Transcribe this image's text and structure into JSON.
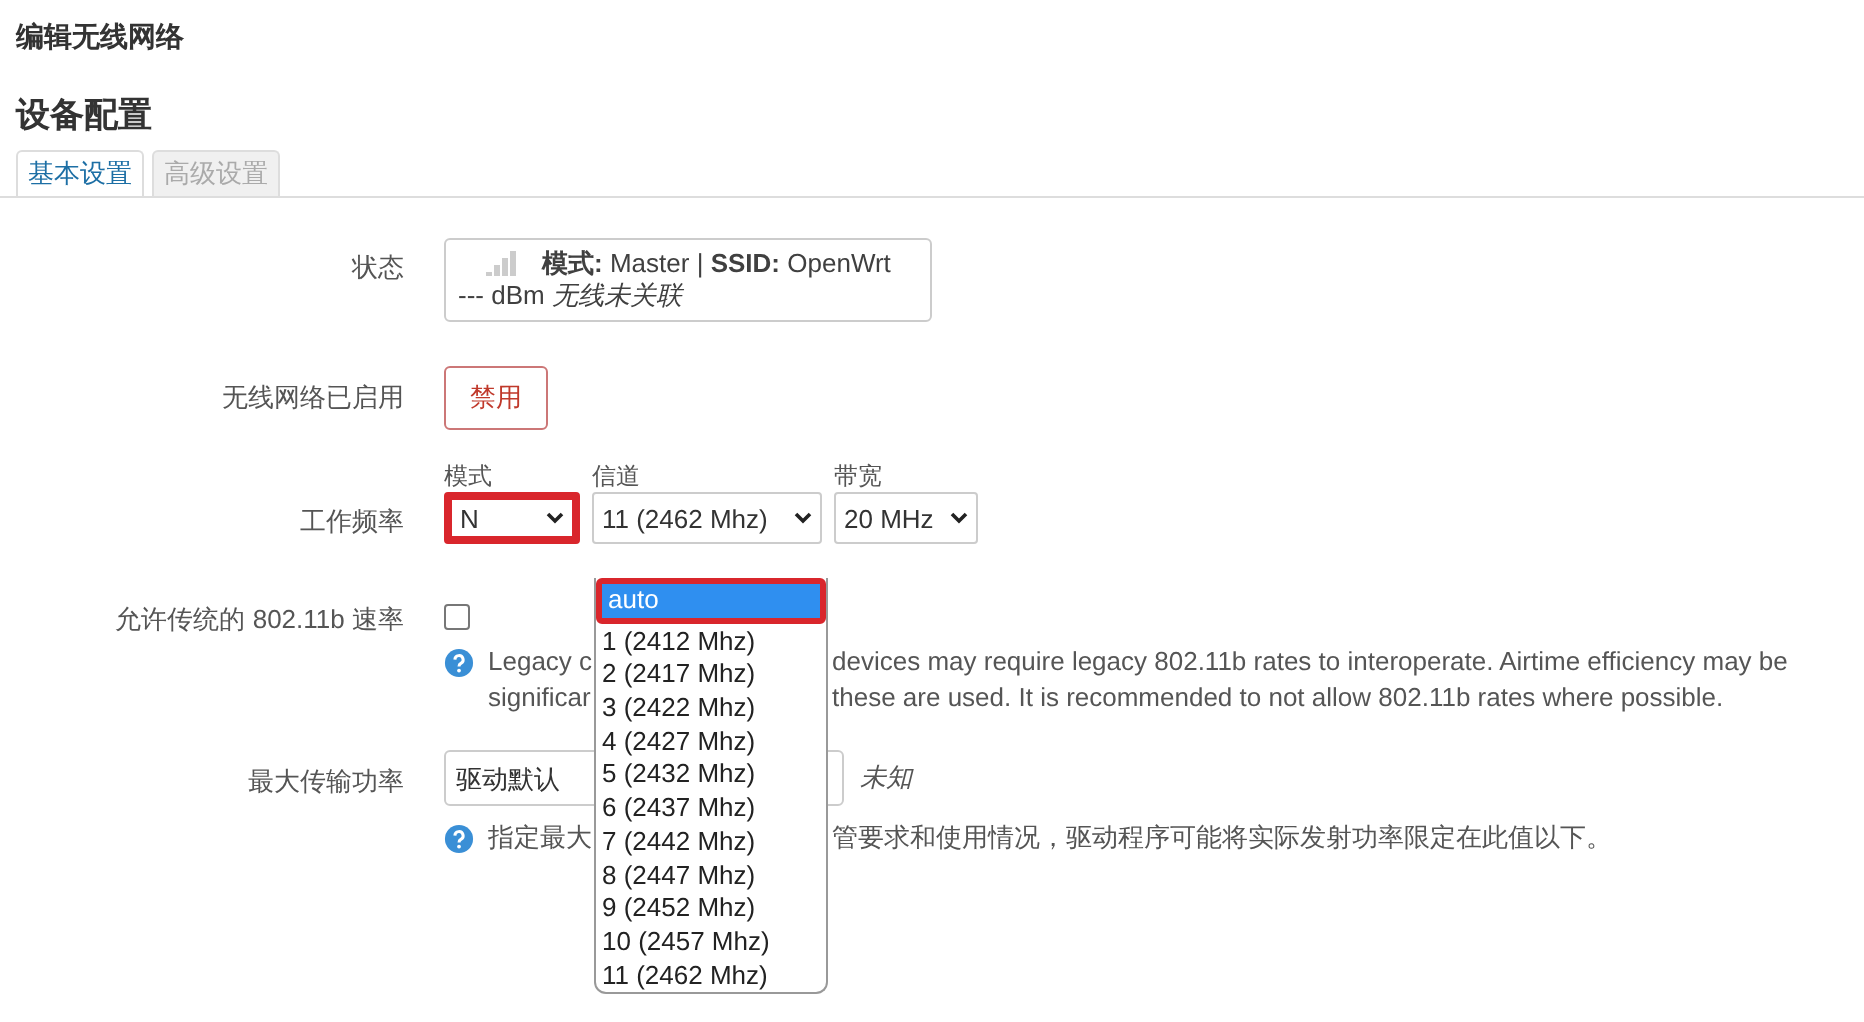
{
  "title": "编辑无线网络",
  "section": "设备配置",
  "tabs": [
    {
      "label": "基本设置",
      "selected": true
    },
    {
      "label": "高级设置",
      "selected": false
    }
  ],
  "fields": [
    {
      "kind": "status",
      "label": "状态",
      "mode_label": "模式:",
      "mode": "Master",
      "separator": "|",
      "ssid_label": "SSID:",
      "ssid": "OpenWrt",
      "signal": "--- dBm",
      "note": "无线未关联"
    },
    {
      "kind": "button",
      "label": "无线网络已启用",
      "button": "禁用"
    },
    {
      "kind": "frequency",
      "label": "工作频率",
      "selects": [
        {
          "caption": "模式",
          "value": "N",
          "highlighted": true
        },
        {
          "caption": "信道",
          "value": "11 (2462 Mhz)",
          "highlighted": false
        },
        {
          "caption": "带宽",
          "value": "20 MHz",
          "highlighted": false
        }
      ]
    },
    {
      "kind": "checkbox",
      "label": "允许传统的 802.11b 速率",
      "checked": false,
      "help": [
        [
          "Legacy c",
          "devices may require legacy 802.11b rates to interoperate. Airtime efficiency may be"
        ],
        [
          "significar",
          "these are used. It is recommended to not allow 802.11b rates where possible."
        ]
      ]
    },
    {
      "kind": "power",
      "label": "最大传输功率",
      "value": "驱动默认",
      "current": "未知",
      "help": [
        [
          "指定最大",
          "管要求和使用情况，驱动程序可能将实际发射功率限定在此值以下。"
        ]
      ]
    }
  ],
  "channel_dropdown": {
    "options": [
      {
        "label": "auto",
        "selected": true,
        "highlighted": true
      },
      {
        "label": "1 (2412 Mhz)",
        "selected": false,
        "highlighted": false
      },
      {
        "label": "2 (2417 Mhz)",
        "selected": false,
        "highlighted": false
      },
      {
        "label": "3 (2422 Mhz)",
        "selected": false,
        "highlighted": false
      },
      {
        "label": "4 (2427 Mhz)",
        "selected": false,
        "highlighted": false
      },
      {
        "label": "5 (2432 Mhz)",
        "selected": false,
        "highlighted": false
      },
      {
        "label": "6 (2437 Mhz)",
        "selected": false,
        "highlighted": false
      },
      {
        "label": "7 (2442 Mhz)",
        "selected": false,
        "highlighted": false
      },
      {
        "label": "8 (2447 Mhz)",
        "selected": false,
        "highlighted": false
      },
      {
        "label": "9 (2452 Mhz)",
        "selected": false,
        "highlighted": false
      },
      {
        "label": "10 (2457 Mhz)",
        "selected": false,
        "highlighted": false
      },
      {
        "label": "11 (2462 Mhz)",
        "selected": false,
        "highlighted": false
      }
    ]
  }
}
